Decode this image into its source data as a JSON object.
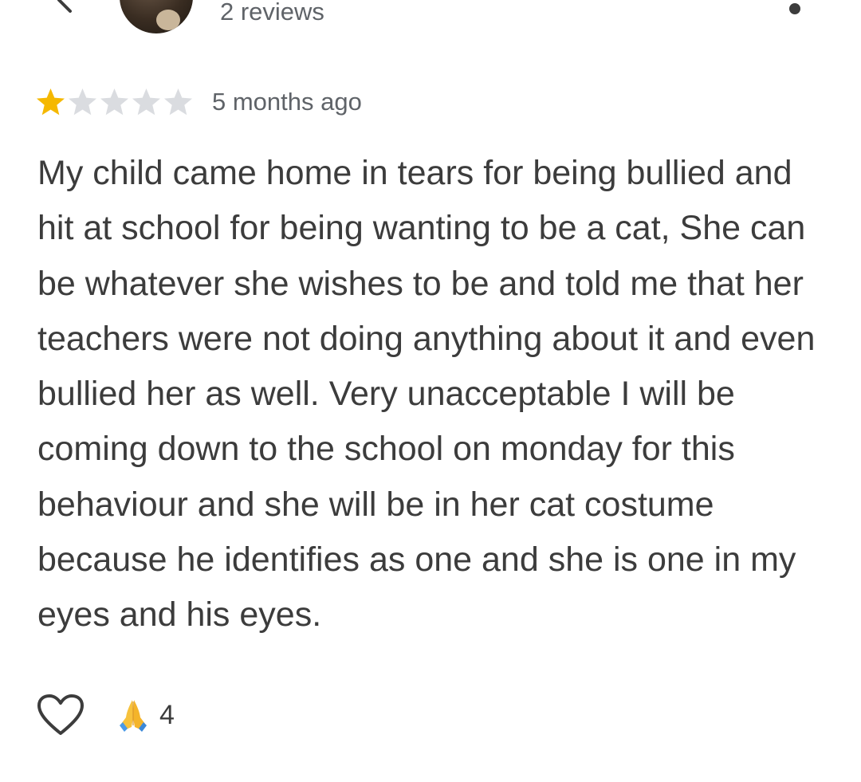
{
  "reviewer": {
    "meta": "2 reviews"
  },
  "review": {
    "rating": 1,
    "max_rating": 5,
    "time": "5 months ago",
    "text": "My child came home in tears for being bullied and hit at school for being wanting to be a cat, She can be whatever she wishes to be and told me that her teachers were not doing anything about it and even bullied her as well. Very unacceptable I will be coming down to the school on monday for this behaviour and she will be in her cat costume because he identifies as one and she is one in my eyes and his eyes."
  },
  "actions": {
    "like_icon": "heart-outline-icon",
    "reaction_icon": "folded-hands-icon",
    "reaction_count": "4"
  },
  "icons": {
    "back": "chevron-left-icon",
    "menu": "more-dots-icon"
  },
  "colors": {
    "star_filled": "#f5b800",
    "star_empty": "#dadce0",
    "text": "#3c3c3c",
    "secondary_text": "#5f6368"
  }
}
